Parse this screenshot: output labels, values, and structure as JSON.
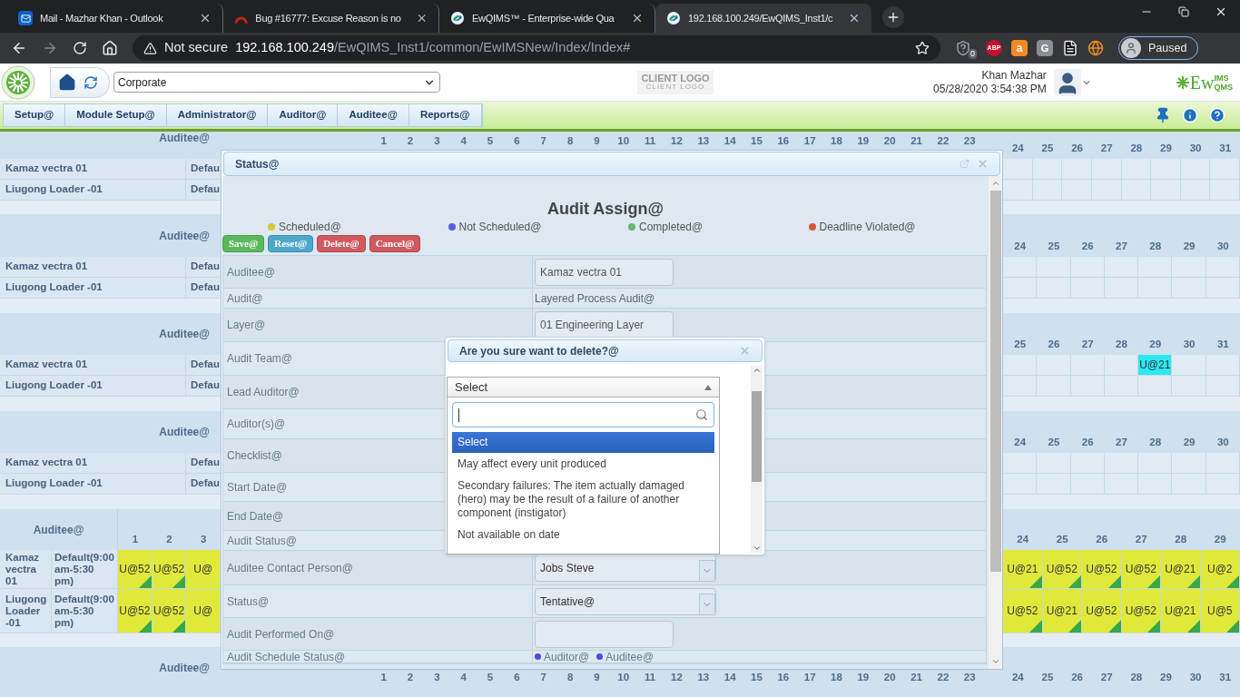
{
  "browser": {
    "tabs": [
      {
        "title": "Mail - Mazhar Khan - Outlook",
        "selected": false,
        "kind": "mail"
      },
      {
        "title": "Bug #16777: Excuse Reason is no",
        "selected": false,
        "kind": "bug"
      },
      {
        "title": "EwQIMS™ - Enterprise-wide Qua",
        "selected": false,
        "kind": "app"
      },
      {
        "title": "192.168.100.249/EwQIMS_Inst1/c",
        "selected": true,
        "kind": "app"
      }
    ],
    "security": "Not secure",
    "host": "192.168.100.249",
    "path": "/EwQIMS_Inst1/common/EwIMSNew/Index/Index#",
    "extensions": [
      {
        "kind": "shield",
        "label": "0"
      },
      {
        "kind": "adblock",
        "label": "ABP"
      },
      {
        "kind": "bag",
        "label": "a"
      },
      {
        "kind": "letter",
        "label": "G"
      },
      {
        "kind": "doc"
      },
      {
        "kind": "globe"
      }
    ],
    "profile": "Paused"
  },
  "app_header": {
    "site": "Corporate",
    "client_logo": "CLIENT LOGO",
    "client_logo_caption": "CLIENT LOGO",
    "user": "Khan Mazhar",
    "datetime": "05/28/2020 3:54:38 PM",
    "brand": {
      "main": "Ew",
      "top": "IMS",
      "bottom": "QMS"
    }
  },
  "menu": [
    "Setup@",
    "Module Setup@",
    "Administrator@",
    "Auditor@",
    "Auditee@",
    "Reports@"
  ],
  "schedule": {
    "top_days": [
      "1",
      "2",
      "3",
      "4",
      "5",
      "6",
      "7",
      "8",
      "9",
      "10",
      "11",
      "12",
      "13",
      "14",
      "15",
      "16",
      "17",
      "18",
      "19",
      "20",
      "21",
      "22",
      "23"
    ],
    "bottom_days": [
      "1",
      "2",
      "3",
      "4",
      "5",
      "6",
      "7",
      "8",
      "9",
      "10",
      "11",
      "12",
      "13",
      "14",
      "15",
      "16",
      "17",
      "18",
      "19",
      "20",
      "21",
      "22",
      "23"
    ],
    "sections": [
      {
        "kind": "plain",
        "label": "Auditee@",
        "days": [
          "24",
          "25",
          "26",
          "27",
          "28",
          "29",
          "30",
          "31"
        ],
        "rows": [
          {
            "name": "Kamaz vectra 01",
            "shift": "Defau",
            "cells": [
              {
                "kind": "empty"
              },
              {
                "kind": "empty"
              },
              {
                "kind": "empty"
              },
              {
                "kind": "empty"
              },
              {
                "kind": "empty"
              },
              {
                "kind": "empty"
              },
              {
                "kind": "empty"
              },
              {
                "kind": "empty"
              }
            ]
          },
          {
            "name": "Liugong Loader -01",
            "shift": "Defau",
            "cells": [
              {
                "kind": "empty"
              },
              {
                "kind": "empty"
              },
              {
                "kind": "empty"
              },
              {
                "kind": "empty"
              },
              {
                "kind": "empty"
              },
              {
                "kind": "empty"
              },
              {
                "kind": "empty"
              },
              {
                "kind": "empty"
              }
            ]
          }
        ]
      },
      {
        "kind": "plain",
        "label": "Auditee@",
        "days": [
          "24",
          "25",
          "26",
          "27",
          "28",
          "29",
          "30"
        ],
        "rows": [
          {
            "name": "Kamaz vectra 01",
            "shift": "Defau",
            "cells": [
              {
                "kind": "empty"
              },
              {
                "kind": "empty"
              },
              {
                "kind": "empty"
              },
              {
                "kind": "empty"
              },
              {
                "kind": "empty"
              },
              {
                "kind": "empty"
              },
              {
                "kind": "empty"
              }
            ]
          },
          {
            "name": "Liugong Loader -01",
            "shift": "Defau",
            "cells": [
              {
                "kind": "empty"
              },
              {
                "kind": "empty"
              },
              {
                "kind": "empty"
              },
              {
                "kind": "empty"
              },
              {
                "kind": "empty"
              },
              {
                "kind": "empty"
              },
              {
                "kind": "empty"
              }
            ]
          }
        ]
      },
      {
        "kind": "plain",
        "label": "Auditee@",
        "days": [
          "25",
          "26",
          "27",
          "28",
          "29",
          "30",
          "31"
        ],
        "rows": [
          {
            "name": "Kamaz vectra 01",
            "shift": "Defau",
            "cells": [
              {
                "kind": "empty"
              },
              {
                "kind": "empty"
              },
              {
                "kind": "empty"
              },
              {
                "kind": "empty"
              },
              {
                "kind": "entry",
                "text": "U@21",
                "color": "#2ce8f0",
                "flagged": false
              },
              {
                "kind": "empty"
              },
              {
                "kind": "empty"
              }
            ]
          },
          {
            "name": "Liugong Loader -01",
            "shift": "Defau",
            "cells": [
              {
                "kind": "empty"
              },
              {
                "kind": "empty"
              },
              {
                "kind": "empty"
              },
              {
                "kind": "empty"
              },
              {
                "kind": "empty"
              },
              {
                "kind": "empty"
              },
              {
                "kind": "empty"
              }
            ]
          }
        ]
      },
      {
        "kind": "plain",
        "label": "Auditee@",
        "days": [
          "24",
          "25",
          "26",
          "27",
          "28",
          "29",
          "30"
        ],
        "rows": [
          {
            "name": "Kamaz vectra 01",
            "shift": "Defau",
            "cells": [
              {
                "kind": "empty"
              },
              {
                "kind": "empty"
              },
              {
                "kind": "empty"
              },
              {
                "kind": "empty"
              },
              {
                "kind": "empty"
              },
              {
                "kind": "empty"
              },
              {
                "kind": "empty"
              }
            ]
          },
          {
            "name": "Liugong Loader -01",
            "shift": "Defau",
            "cells": [
              {
                "kind": "empty"
              },
              {
                "kind": "empty"
              },
              {
                "kind": "empty"
              },
              {
                "kind": "empty"
              },
              {
                "kind": "empty"
              },
              {
                "kind": "empty"
              },
              {
                "kind": "empty"
              }
            ]
          }
        ]
      },
      {
        "kind": "detail",
        "label": "Auditee@",
        "left_days": [
          "1",
          "2",
          "3"
        ],
        "days": [
          "24",
          "25",
          "26",
          "27",
          "28",
          "29"
        ],
        "rows": [
          {
            "name": "Kamaz vectra 01",
            "shift": "Default(9:00 am-5:30 pm)",
            "left_cells": [
              {
                "kind": "entry",
                "text": "U@52",
                "color": "#dfe93a",
                "flagged": true
              },
              {
                "kind": "entry",
                "text": "U@52",
                "color": "#dfe93a",
                "flagged": true
              },
              {
                "kind": "entry",
                "text": "U@",
                "color": "#dfe93a",
                "flagged": false
              }
            ],
            "cells": [
              {
                "kind": "entry",
                "text": "U@21",
                "color": "#dfe93a",
                "flagged": true
              },
              {
                "kind": "entry",
                "text": "U@52",
                "color": "#dfe93a",
                "flagged": true
              },
              {
                "kind": "entry",
                "text": "U@52",
                "color": "#dfe93a",
                "flagged": true
              },
              {
                "kind": "entry",
                "text": "U@52",
                "color": "#dfe93a",
                "flagged": true
              },
              {
                "kind": "entry",
                "text": "U@21",
                "color": "#dfe93a",
                "flagged": true
              },
              {
                "kind": "entry",
                "text": "U@2",
                "color": "#dfe93a",
                "flagged": true
              }
            ]
          },
          {
            "name": "Liugong Loader -01",
            "shift": "Default(9:00 am-5:30 pm)",
            "left_cells": [
              {
                "kind": "entry",
                "text": "U@52",
                "color": "#dfe93a",
                "flagged": true
              },
              {
                "kind": "entry",
                "text": "U@52",
                "color": "#dfe93a",
                "flagged": true
              },
              {
                "kind": "entry",
                "text": "U@",
                "color": "#dfe93a",
                "flagged": false
              }
            ],
            "cells": [
              {
                "kind": "entry",
                "text": "U@52",
                "color": "#dfe93a",
                "flagged": true
              },
              {
                "kind": "entry",
                "text": "U@21",
                "color": "#dfe93a",
                "flagged": true
              },
              {
                "kind": "entry",
                "text": "U@52",
                "color": "#dfe93a",
                "flagged": true
              },
              {
                "kind": "entry",
                "text": "U@52",
                "color": "#dfe93a",
                "flagged": true
              },
              {
                "kind": "entry",
                "text": "U@21",
                "color": "#dfe93a",
                "flagged": true
              },
              {
                "kind": "entry",
                "text": "U@5",
                "color": "#dfe93a",
                "flagged": true
              }
            ]
          }
        ]
      },
      {
        "kind": "header_only",
        "label": "Auditee@",
        "days": [
          "24",
          "25",
          "26",
          "27",
          "28",
          "29",
          "30",
          "31"
        ]
      }
    ]
  },
  "dialog": {
    "title": "Status@",
    "heading": "Audit Assign@",
    "legend": [
      {
        "label": "Scheduled@",
        "color": "#e0c531"
      },
      {
        "label": "Not Scheduled@",
        "color": "#5a5ae6"
      },
      {
        "label": "Completed@",
        "color": "#6cb36c"
      },
      {
        "label": "Deadline Violated@",
        "color": "#d9573b"
      }
    ],
    "buttons": [
      {
        "label": "Save@",
        "kind": "save"
      },
      {
        "label": "Reset@",
        "kind": "reset"
      },
      {
        "label": "Delete@",
        "kind": "delete"
      },
      {
        "label": "Cancel@",
        "kind": "cancel"
      }
    ],
    "fields": [
      {
        "label": "Auditee@",
        "kind": "input",
        "value": "Kamaz vectra 01"
      },
      {
        "label": "Audit@",
        "kind": "text",
        "value": "Layered Process Audit@"
      },
      {
        "label": "Layer@",
        "kind": "input",
        "value": "01 Engineering Layer"
      },
      {
        "label": "Audit Team@",
        "kind": "empty"
      },
      {
        "label": "Lead Auditor@",
        "kind": "empty"
      },
      {
        "label": "Auditor(s)@",
        "kind": "empty"
      },
      {
        "label": "Checklist@",
        "kind": "empty"
      },
      {
        "label": "Start Date@",
        "kind": "empty"
      },
      {
        "label": "End Date@",
        "kind": "empty"
      },
      {
        "label": "Audit Status@",
        "kind": "empty"
      },
      {
        "label": "Auditee Contact Person@",
        "kind": "combo",
        "value": "Jobs Steve"
      },
      {
        "label": "Status@",
        "kind": "combo",
        "value": "Tentative@"
      },
      {
        "label": "Audit Performed On@",
        "kind": "input"
      },
      {
        "label": "Audit Schedule Status@",
        "kind": "radios",
        "options": [
          "Auditor@",
          "Auditee@"
        ]
      }
    ]
  },
  "popup": {
    "title": "Are you sure want to delete?@",
    "select": {
      "value": "Select",
      "expanded": true
    },
    "options": [
      {
        "label": "Select",
        "selected": true
      },
      {
        "label": "May affect every unit produced",
        "selected": false
      },
      {
        "label": "Secondary failures: The item actually damaged (hero) may be the result of a failure of another component (instigator)",
        "selected": false
      },
      {
        "label": "Not available on date",
        "selected": false
      }
    ]
  }
}
